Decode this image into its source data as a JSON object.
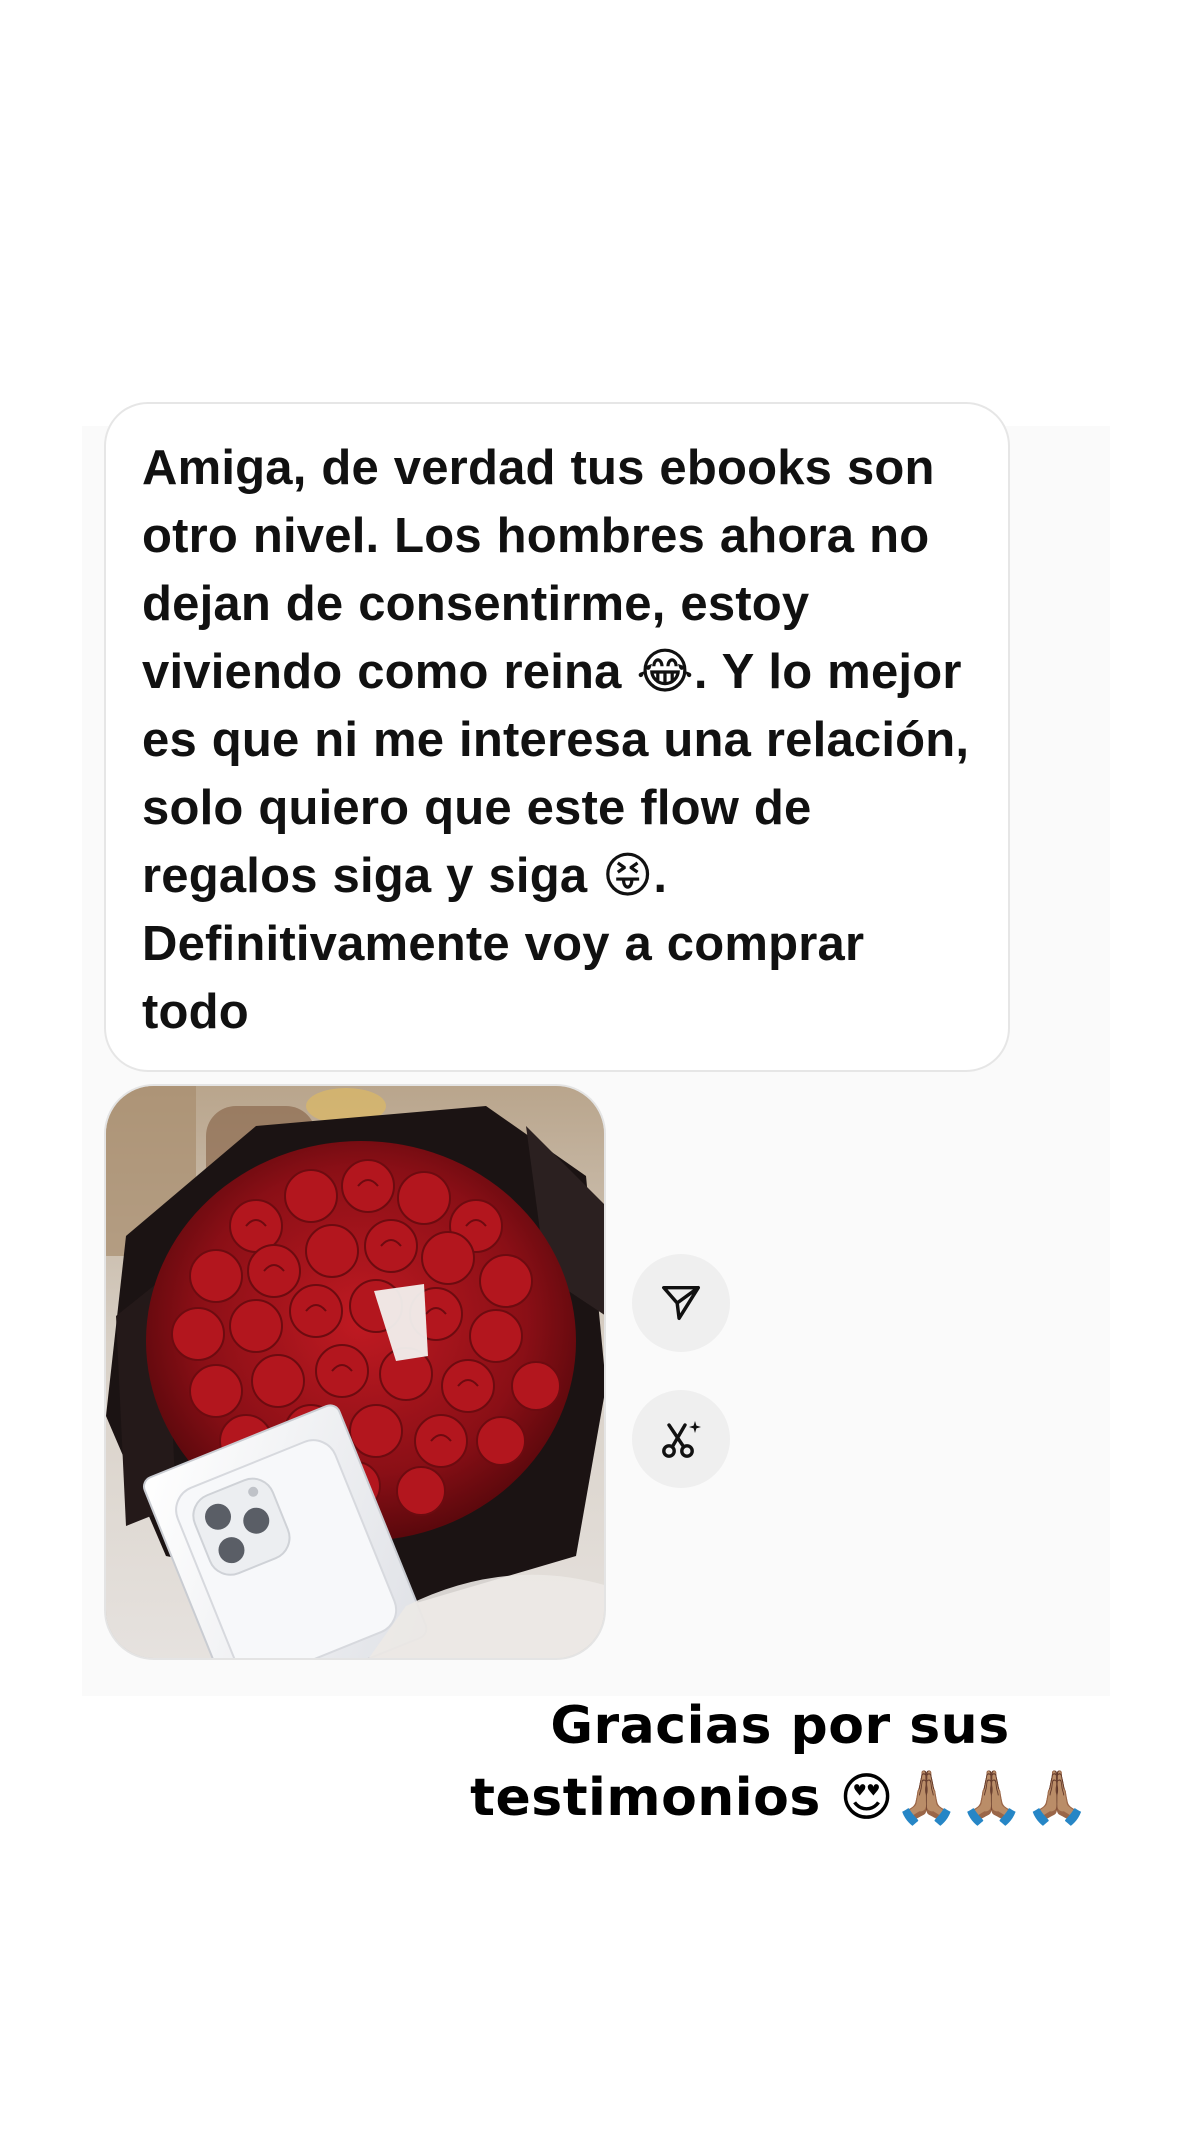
{
  "message": {
    "text": "Amiga, de verdad tus ebooks son otro nivel. Los hombres ahora no dejan de consentirme, estoy viviendo como reina 😂. Y lo mejor es que ni me interesa una relación, solo quiero que este flow de regalos siga y siga 😝. Definitivamente voy a comprar todo"
  },
  "photo": {
    "subject": "bouquet of red roses with a white phone box",
    "colors": {
      "rose": "#9e1219",
      "wrap": "#1b1313",
      "box": "#f3f3f5",
      "background": "#c9bfb5"
    }
  },
  "actions": {
    "share_icon": "send-icon",
    "cutout_icon": "scissors-sparkle-icon"
  },
  "caption": {
    "line1": "Gracias por sus",
    "line2": "testimonios 😍🙏🏽🙏🏽🙏🏽"
  },
  "colors": {
    "bubble_border": "#e6e6e6",
    "panel": "#fafafa",
    "button_bg": "#efefef",
    "text": "#111111"
  }
}
